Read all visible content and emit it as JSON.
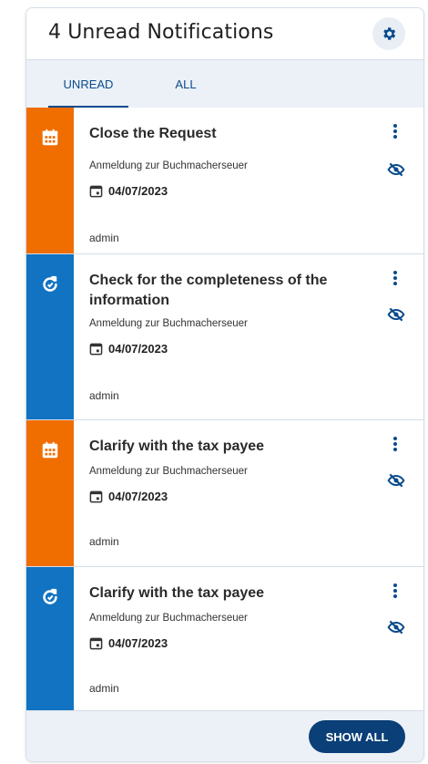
{
  "header": {
    "title": "4 Unread Notifications",
    "settings_icon": "gear-icon"
  },
  "tabs": [
    {
      "label": "UNREAD",
      "active": true
    },
    {
      "label": "ALL",
      "active": false
    }
  ],
  "colors": {
    "orange": "#f06d00",
    "blue": "#1173c2",
    "navy": "#0a4b8c"
  },
  "notifications": [
    {
      "title": "Close the Request",
      "subtitle": "Anmeldung zur Buchmacherseuer",
      "date": "04/07/2023",
      "user": "admin",
      "type_icon": "calendar-grid-icon",
      "color": "orange"
    },
    {
      "title": "Check for the completeness of the information",
      "subtitle": "Anmeldung zur Buchmacherseuer",
      "date": "04/07/2023",
      "user": "admin",
      "type_icon": "refresh-icon",
      "color": "blue"
    },
    {
      "title": "Clarify with the tax payee",
      "subtitle": "Anmeldung zur Buchmacherseuer",
      "date": "04/07/2023",
      "user": "admin",
      "type_icon": "calendar-grid-icon",
      "color": "orange"
    },
    {
      "title": "Clarify with the tax payee",
      "subtitle": "Anmeldung zur Buchmacherseuer",
      "date": "04/07/2023",
      "user": "admin",
      "type_icon": "refresh-icon",
      "color": "blue"
    }
  ],
  "footer": {
    "show_all_label": "SHOW ALL"
  }
}
